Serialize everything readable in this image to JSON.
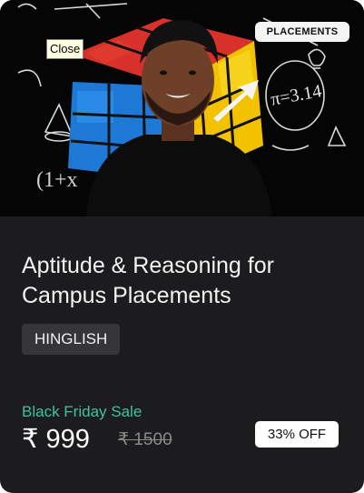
{
  "banner": {
    "category_tag": "PLACEMENTS",
    "tooltip": "Close",
    "chalk_text": "π=3.14",
    "chalk_formula": "(1+x"
  },
  "course": {
    "title": "Aptitude & Reasoning for Campus Placements",
    "language": "HINGLISH"
  },
  "pricing": {
    "sale_label": "Black Friday Sale",
    "price": "₹ 999",
    "original_price": "₹ 1500",
    "discount": "33% OFF"
  },
  "colors": {
    "card_background": "#1c1c1e",
    "sale_accent": "#3fc29a",
    "chip_background": "#36363a"
  }
}
